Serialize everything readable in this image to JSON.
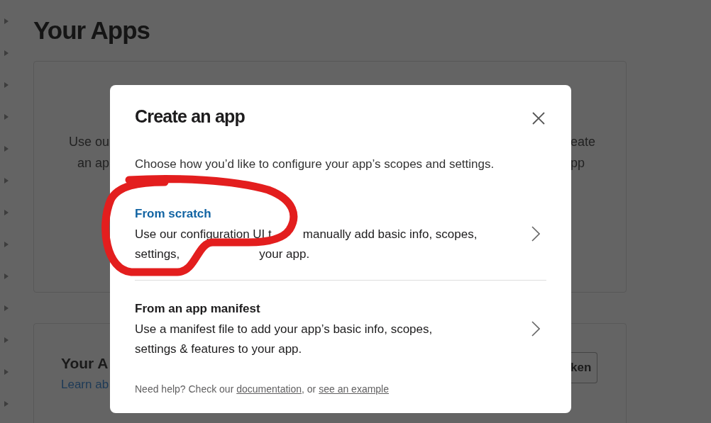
{
  "page": {
    "title": "Your Apps"
  },
  "intro_card": {
    "left_lines": [
      "Use ou",
      "an ap"
    ],
    "right_lines": [
      "eate",
      "pp"
    ]
  },
  "list_card": {
    "heading": "Your A",
    "link": "Learn ab",
    "button": "ken"
  },
  "modal": {
    "title": "Create an app",
    "subtitle": "Choose how you’d like to configure your app’s scopes and settings.",
    "options": [
      {
        "title": "From scratch",
        "highlighted": true,
        "lines": [
          [
            "Use our configuration UI t",
            "manually add basic info, scopes,"
          ],
          [
            "settings,",
            "your app."
          ]
        ]
      },
      {
        "title": "From an app manifest",
        "highlighted": false,
        "lines": [
          [
            "Use a manifest file to add your app’s basic info, scopes,"
          ],
          [
            "settings & features to your app."
          ]
        ]
      }
    ],
    "help": [
      {
        "kind": "text",
        "text": "Need help? Check our "
      },
      {
        "kind": "link",
        "text": "documentation"
      },
      {
        "kind": "text",
        "text": ", or "
      },
      {
        "kind": "link",
        "text": "see an example"
      }
    ]
  }
}
